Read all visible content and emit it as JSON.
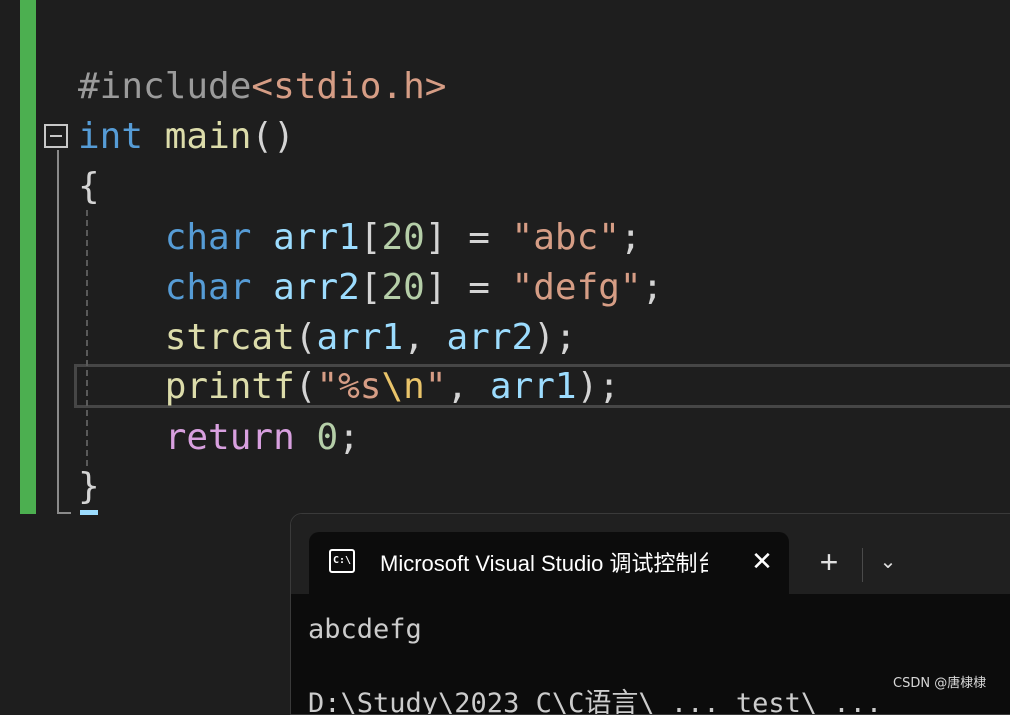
{
  "editor": {
    "lines": [
      {
        "tokens": [
          {
            "t": "#include",
            "c": "pre"
          },
          {
            "t": "<stdio.h>",
            "c": "inc"
          }
        ]
      },
      {
        "tokens": [
          {
            "t": "int",
            "c": "kw"
          },
          {
            "t": " ",
            "c": "punc"
          },
          {
            "t": "main",
            "c": "fn"
          },
          {
            "t": "()",
            "c": "punc"
          }
        ]
      },
      {
        "tokens": [
          {
            "t": "{",
            "c": "punc"
          }
        ]
      },
      {
        "tokens": [
          {
            "t": "    ",
            "c": "punc"
          },
          {
            "t": "char",
            "c": "kw"
          },
          {
            "t": " ",
            "c": "punc"
          },
          {
            "t": "arr1",
            "c": "var"
          },
          {
            "t": "[",
            "c": "punc"
          },
          {
            "t": "20",
            "c": "num"
          },
          {
            "t": "] = ",
            "c": "punc"
          },
          {
            "t": "\"abc\"",
            "c": "str"
          },
          {
            "t": ";",
            "c": "punc"
          }
        ]
      },
      {
        "tokens": [
          {
            "t": "    ",
            "c": "punc"
          },
          {
            "t": "char",
            "c": "kw"
          },
          {
            "t": " ",
            "c": "punc"
          },
          {
            "t": "arr2",
            "c": "var"
          },
          {
            "t": "[",
            "c": "punc"
          },
          {
            "t": "20",
            "c": "num"
          },
          {
            "t": "] = ",
            "c": "punc"
          },
          {
            "t": "\"defg\"",
            "c": "str"
          },
          {
            "t": ";",
            "c": "punc"
          }
        ]
      },
      {
        "tokens": [
          {
            "t": "    ",
            "c": "punc"
          },
          {
            "t": "strcat",
            "c": "fn"
          },
          {
            "t": "(",
            "c": "punc"
          },
          {
            "t": "arr1",
            "c": "var"
          },
          {
            "t": ", ",
            "c": "punc"
          },
          {
            "t": "arr2",
            "c": "var"
          },
          {
            "t": ");",
            "c": "punc"
          }
        ]
      },
      {
        "tokens": [
          {
            "t": "    ",
            "c": "punc"
          },
          {
            "t": "printf",
            "c": "fn"
          },
          {
            "t": "(",
            "c": "punc"
          },
          {
            "t": "\"",
            "c": "str"
          },
          {
            "t": "%s",
            "c": "str"
          },
          {
            "t": "\\n",
            "c": "esc"
          },
          {
            "t": "\"",
            "c": "str"
          },
          {
            "t": ", ",
            "c": "punc"
          },
          {
            "t": "arr1",
            "c": "var"
          },
          {
            "t": ");",
            "c": "punc"
          }
        ]
      },
      {
        "tokens": [
          {
            "t": "    ",
            "c": "punc"
          },
          {
            "t": "return",
            "c": "ctl"
          },
          {
            "t": " ",
            "c": "punc"
          },
          {
            "t": "0",
            "c": "num"
          },
          {
            "t": ";",
            "c": "punc"
          }
        ]
      },
      {
        "tokens": [
          {
            "t": "}",
            "c": "punc"
          }
        ]
      }
    ],
    "colors": {
      "background": "#1e1e1e",
      "change_bar": "#4caf50",
      "keyword": "#569cd6",
      "function": "#dcdcaa",
      "variable": "#9cdcfe",
      "number": "#b5cea8",
      "string": "#d69d85",
      "control": "#d8a0df"
    }
  },
  "terminal": {
    "tab_icon_text": "C:\\",
    "tab_title": "Microsoft Visual Studio 调试控制台",
    "close_glyph": "✕",
    "new_tab_glyph": "+",
    "dropdown_glyph": "⌄",
    "output": "abcdefg",
    "path_line": "D:\\Study\\2023 C\\C语言\\ ... test\\ ...",
    "colors": {
      "background": "#0c0c0c",
      "titlebar": "#202020",
      "text": "#cccccc"
    }
  },
  "watermark": "CSDN @唐棣棣"
}
